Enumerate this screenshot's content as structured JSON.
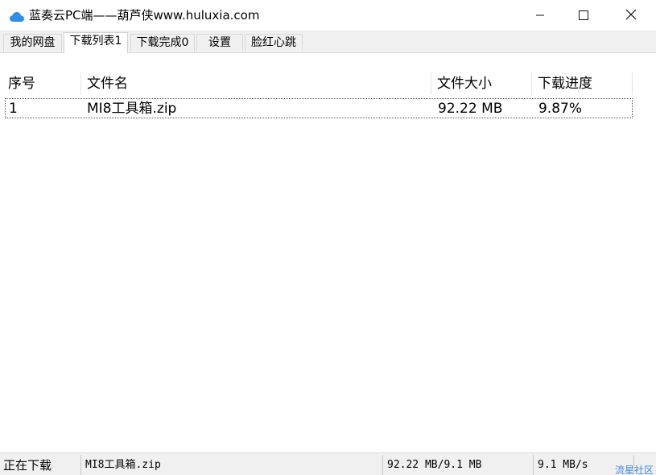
{
  "window": {
    "title": "蓝奏云PC端——葫芦侠www.huluxia.com",
    "icon": "cloud-icon",
    "controls": {
      "minimize": "minimize-icon",
      "maximize": "maximize-icon",
      "close": "close-icon"
    }
  },
  "tabs": [
    {
      "label": "我的网盘",
      "active": false
    },
    {
      "label": "下载列表1",
      "active": true
    },
    {
      "label": "下载完成0",
      "active": false
    },
    {
      "label": "设置",
      "active": false
    },
    {
      "label": "脸红心跳",
      "active": false
    }
  ],
  "list": {
    "columns": [
      "序号",
      "文件名",
      "文件大小",
      "下载进度"
    ],
    "rows": [
      {
        "index": "1",
        "filename": "MI8工具箱.zip",
        "size": "92.22 MB",
        "progress": "9.87%"
      }
    ]
  },
  "statusbar": {
    "state": "正在下载",
    "filename": "MI8工具箱.zip",
    "transfer": "92.22 MB/9.1 MB",
    "speed": "9.1 MB/s"
  },
  "watermark": "流星社区",
  "colors": {
    "accent": "#2f7fd8",
    "background": "#ffffff",
    "chrome": "#f0f0f0"
  }
}
